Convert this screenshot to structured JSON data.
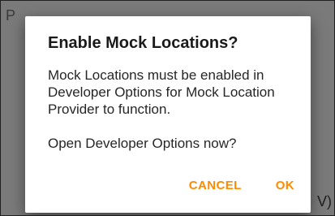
{
  "background": {
    "top_left_text": "P",
    "bottom_right_text": "V)"
  },
  "dialog": {
    "title": "Enable Mock Locations?",
    "message_line_1": "Mock Locations must be enabled in Developer Options for Mock Location Provider to function.",
    "message_line_2": "Open Developer Options now?",
    "cancel_label": "CANCEL",
    "ok_label": "OK"
  },
  "colors": {
    "accent": "#ff8a00",
    "scrim": "#7a7a7a",
    "dialog_bg": "#ffffff"
  }
}
